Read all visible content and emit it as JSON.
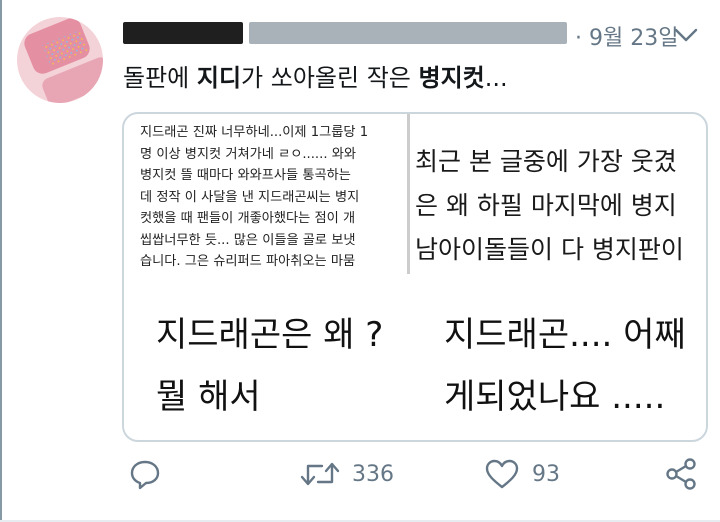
{
  "tweet": {
    "date": "9월 23일",
    "text_parts": [
      "돌판에 ",
      "지디",
      "가 쏘아올린 작은 ",
      "병지컷",
      "..."
    ]
  },
  "media": {
    "panel1_text": "지드래곤 진짜 너무하네...이제 1그룹당 1\n명 이상 병지컷 거쳐가네 ㄹㅇ...... 와와\n병지컷 뜰 때마다 와와프사들 통곡하는\n데 정작 이 사달을 낸 지드래곤씨는 병지\n컷했을 때 팬들이 개좋아했다는 점이 개\n씹쌉너무한 듯... 많은 이들을 골로 보냇\n습니다. 그은 슈리퍼드 파아취오는 마뭄",
    "panel2_text": "최근 본 글중에 가장 웃겼\n은 왜 하필 마지막에 병지\n남아이돌들이 다 병지판이",
    "panel3_text": "지드래곤은 왜 ?\n뭘 해서",
    "panel4_text": "지드래곤.... 어째\n게되었나요 ....."
  },
  "actions": {
    "reply_icon": "reply-icon",
    "retweet_count": "336",
    "like_count": "93",
    "share_icon": "share-icon"
  },
  "colors": {
    "muted": "#657786",
    "border": "#ccd6dd",
    "text": "#14171a"
  }
}
